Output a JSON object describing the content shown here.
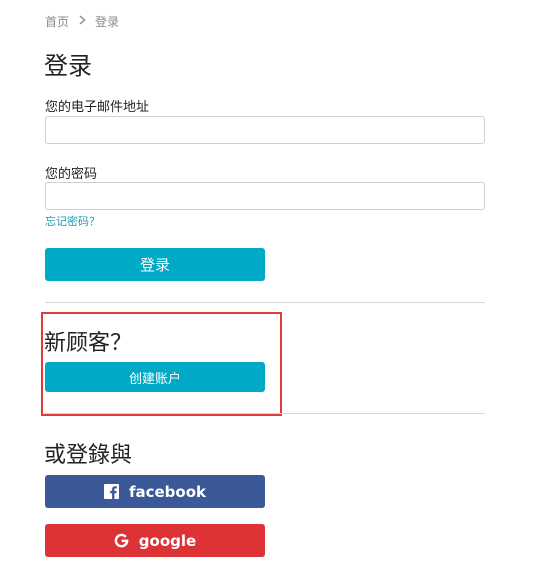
{
  "breadcrumb": {
    "home": "首页",
    "current": "登录"
  },
  "page_title": "登录",
  "email": {
    "label": "您的电子邮件地址",
    "value": "",
    "placeholder": ""
  },
  "password": {
    "label": "您的密码",
    "value": "",
    "placeholder": ""
  },
  "forgot_password": "忘记密码？",
  "login_button": "登录",
  "new_customer": {
    "title": "新顾客？",
    "button": "创建账户"
  },
  "social": {
    "title": "或登錄與",
    "facebook": "facebook",
    "google": "google"
  },
  "colors": {
    "accent": "#00a9c6",
    "facebook": "#3b5998",
    "google": "#de3336",
    "highlight": "#e03a3a"
  }
}
